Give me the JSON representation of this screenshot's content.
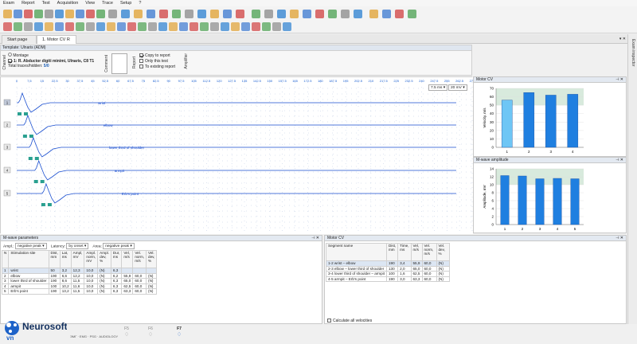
{
  "menu": [
    "Exam",
    "Report",
    "Test",
    "Acquisition",
    "View",
    "Trace",
    "Setup",
    "?"
  ],
  "tabs": [
    {
      "label": "Start page"
    },
    {
      "label": "1. Motor CV R"
    }
  ],
  "template_title": "Template: Ulnaris (ADM)",
  "header": {
    "channel_label": "Channel",
    "montage_label": "Montage",
    "montage_value": "1: R. Abductor digiti minimi, Ulnaris, C8 T1",
    "total_traces_label": "Total traces/hidden:",
    "total_traces_value": "5/0",
    "comment_label": "Comment",
    "report_label": "Report",
    "copy_to_report": "Copy to report",
    "only_this_test": "Only this test",
    "to_existing_report": "To existing report",
    "amplifier_label": "Amplifier"
  },
  "sweep": {
    "timebase": "7.5 ms",
    "gain": "20 mV"
  },
  "time_axis": [
    "0",
    "7.5",
    "15",
    "22.5",
    "30",
    "37.5",
    "45",
    "52.5",
    "60",
    "67.5",
    "75",
    "82.5",
    "90",
    "97.5",
    "105",
    "112.5",
    "120",
    "127.5",
    "135",
    "142.5",
    "150",
    "157.5",
    "165",
    "172.5",
    "180",
    "187.5",
    "195",
    "202.5",
    "210",
    "217.5",
    "225",
    "232.5",
    "240",
    "247.5",
    "255",
    "262.5",
    "270"
  ],
  "traces": [
    {
      "num": "1",
      "site": "wrist"
    },
    {
      "num": "2",
      "site": "elbow"
    },
    {
      "num": "3",
      "site": "lower third of shoulder"
    },
    {
      "num": "4",
      "site": "armpit"
    },
    {
      "num": "5",
      "site": "Erb's point"
    }
  ],
  "motor_cv_chart": {
    "title": "Motor CV",
    "ylabel": "Velocity, m/s"
  },
  "mwave_chart": {
    "title": "M-wave amplitude",
    "ylabel": "Amplitude, mV"
  },
  "mwave_params": {
    "title": "M-wave parameters",
    "ampl_label": "Ampl.:",
    "ampl_value": "negative peak",
    "latency_label": "Latency:",
    "latency_value": "by onset",
    "area_label": "Area:",
    "area_value": "negative peak",
    "headers": [
      "N",
      "Stimulation site",
      "Dist, mm",
      "Lat, ms",
      "Ampl, mV",
      "Ampl. norm, mV",
      "Ampl. dev, %",
      "Dur, ms",
      "Vel, m/s",
      "Vel. norm, m/s",
      "Vel. dev, %"
    ],
    "rows": [
      [
        "1",
        "wrist",
        "50",
        "3,2",
        "12,3",
        "10,0",
        "(N)",
        "6,3",
        "",
        "",
        ""
      ],
      [
        "2",
        "elbow",
        "190",
        "6,6",
        "12,2",
        "10,0",
        "(N)",
        "6,2",
        "55,9",
        "60,0",
        "(N)"
      ],
      [
        "3",
        "lower third of shoulder",
        "190",
        "8,6",
        "11,5",
        "10,0",
        "(N)",
        "6,3",
        "65,0",
        "60,0",
        "(N)"
      ],
      [
        "4",
        "armpit",
        "100",
        "10,2",
        "11,6",
        "10,0",
        "(N)",
        "6,3",
        "62,5",
        "60,0",
        "(N)"
      ],
      [
        "5",
        "Erb's point",
        "190",
        "13,2",
        "11,5",
        "10,0",
        "(N)",
        "6,3",
        "63,3",
        "60,0",
        "(N)"
      ]
    ]
  },
  "motor_cv_table": {
    "title": "Motor CV",
    "headers": [
      "Segment name",
      "Dist, mm",
      "Time, ms",
      "Vel, m/s",
      "Vel. norm, m/s",
      "Vel. dev, %"
    ],
    "rows": [
      [
        "1-2 wrist – elbow",
        "190",
        "3,4",
        "55,9",
        "60,0",
        "(N)"
      ],
      [
        "2-3 elbow – lower third of shoulder",
        "130",
        "2,0",
        "65,0",
        "60,0",
        "(N)"
      ],
      [
        "3-4 lower third of shoulder – armpit",
        "100",
        "1,6",
        "62,5",
        "60,0",
        "(N)"
      ],
      [
        "4-5 armpit – Erb's point",
        "190",
        "3,0",
        "63,3",
        "60,0",
        "(N)"
      ]
    ],
    "calc_all": "Calculate all velocities"
  },
  "fkeys": [
    {
      "key": "F5",
      "sub": ""
    },
    {
      "key": "F6",
      "sub": ""
    },
    {
      "key": "F7",
      "sub": ""
    }
  ],
  "bottom_text": "ЭМГ · EMG · PSG · AUDIOLOGY",
  "logo": "Neurosoft",
  "logo_sub": "vn",
  "side_label": "Exam inspector",
  "chart_data": [
    {
      "type": "bar",
      "title": "Motor CV",
      "categories": [
        "1",
        "2",
        "3",
        "4"
      ],
      "values": [
        56,
        65,
        62,
        63
      ],
      "ylabel": "Velocity, m/s",
      "ylim": [
        0,
        70
      ],
      "yticks": [
        0,
        10,
        20,
        30,
        40,
        50,
        60,
        70
      ],
      "norm_band": [
        50,
        70
      ],
      "colors": [
        "#6ec6f5",
        "#1f7fe0",
        "#1f7fe0",
        "#1f7fe0"
      ]
    },
    {
      "type": "bar",
      "title": "M-wave amplitude",
      "categories": [
        "1",
        "2",
        "3",
        "4",
        "5"
      ],
      "values": [
        12.3,
        12.2,
        11.5,
        11.6,
        11.5
      ],
      "ylabel": "Amplitude, mV",
      "ylim": [
        0,
        14
      ],
      "yticks": [
        0,
        2,
        4,
        6,
        8,
        10,
        12,
        14
      ],
      "norm_band": [
        10,
        14
      ],
      "colors": [
        "#1f7fe0",
        "#1f7fe0",
        "#1f7fe0",
        "#1f7fe0",
        "#1f7fe0"
      ]
    }
  ]
}
